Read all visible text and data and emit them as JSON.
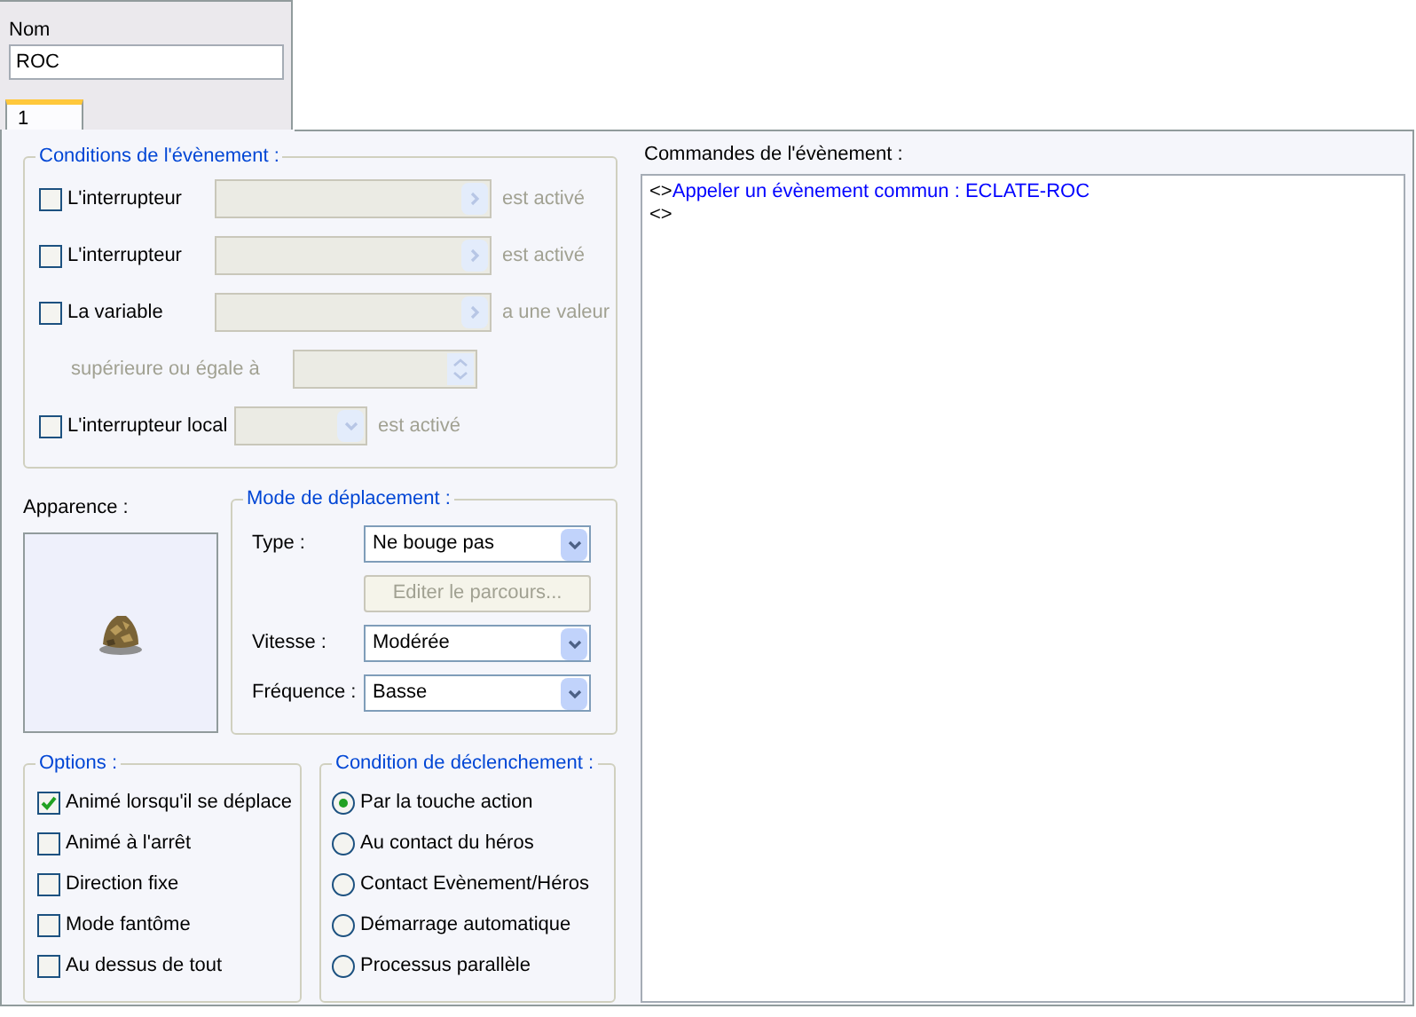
{
  "name_field": {
    "label": "Nom",
    "value": "ROC"
  },
  "tabs": [
    {
      "label": "1",
      "selected": true
    }
  ],
  "conditions": {
    "title": "Conditions de l'évènement :",
    "rows": [
      {
        "kind": "switch",
        "label": "L'interrupteur",
        "checked": false,
        "suffix": "est activé"
      },
      {
        "kind": "switch",
        "label": "L'interrupteur",
        "checked": false,
        "suffix": "est activé"
      },
      {
        "kind": "switch",
        "label": "La variable",
        "checked": false,
        "suffix": "a une valeur"
      },
      {
        "kind": "compare",
        "label": "supérieure ou égale à"
      },
      {
        "kind": "local",
        "label": "L'interrupteur local",
        "checked": false,
        "suffix": "est activé"
      }
    ]
  },
  "appearance": {
    "label": "Apparence :"
  },
  "movement": {
    "title": "Mode de déplacement :",
    "rows": [
      {
        "kind": "select",
        "label": "Type :",
        "value": "Ne bouge pas"
      },
      {
        "kind": "button",
        "label": "Editer le parcours...",
        "disabled": true
      },
      {
        "kind": "select",
        "label": "Vitesse :",
        "value": "Modérée"
      },
      {
        "kind": "select",
        "label": "Fréquence :",
        "value": "Basse"
      }
    ]
  },
  "options": {
    "title": "Options :",
    "items": [
      {
        "label": "Animé lorsqu'il se déplace",
        "checked": true
      },
      {
        "label": "Animé à l'arrêt",
        "checked": false
      },
      {
        "label": "Direction fixe",
        "checked": false
      },
      {
        "label": "Mode fantôme",
        "checked": false
      },
      {
        "label": "Au dessus de tout",
        "checked": false
      }
    ]
  },
  "trigger": {
    "title": "Condition de déclenchement :",
    "items": [
      {
        "label": "Par la touche action",
        "selected": true
      },
      {
        "label": "Au contact du héros",
        "selected": false
      },
      {
        "label": "Contact Evènement/Héros",
        "selected": false
      },
      {
        "label": "Démarrage automatique",
        "selected": false
      },
      {
        "label": "Processus parallèle",
        "selected": false
      }
    ]
  },
  "commands": {
    "label": "Commandes de l'évènement :",
    "lines": [
      {
        "marker": "<>",
        "text": "Appeler un évènement commun : ECLATE-ROC"
      },
      {
        "marker": "<>"
      }
    ]
  }
}
